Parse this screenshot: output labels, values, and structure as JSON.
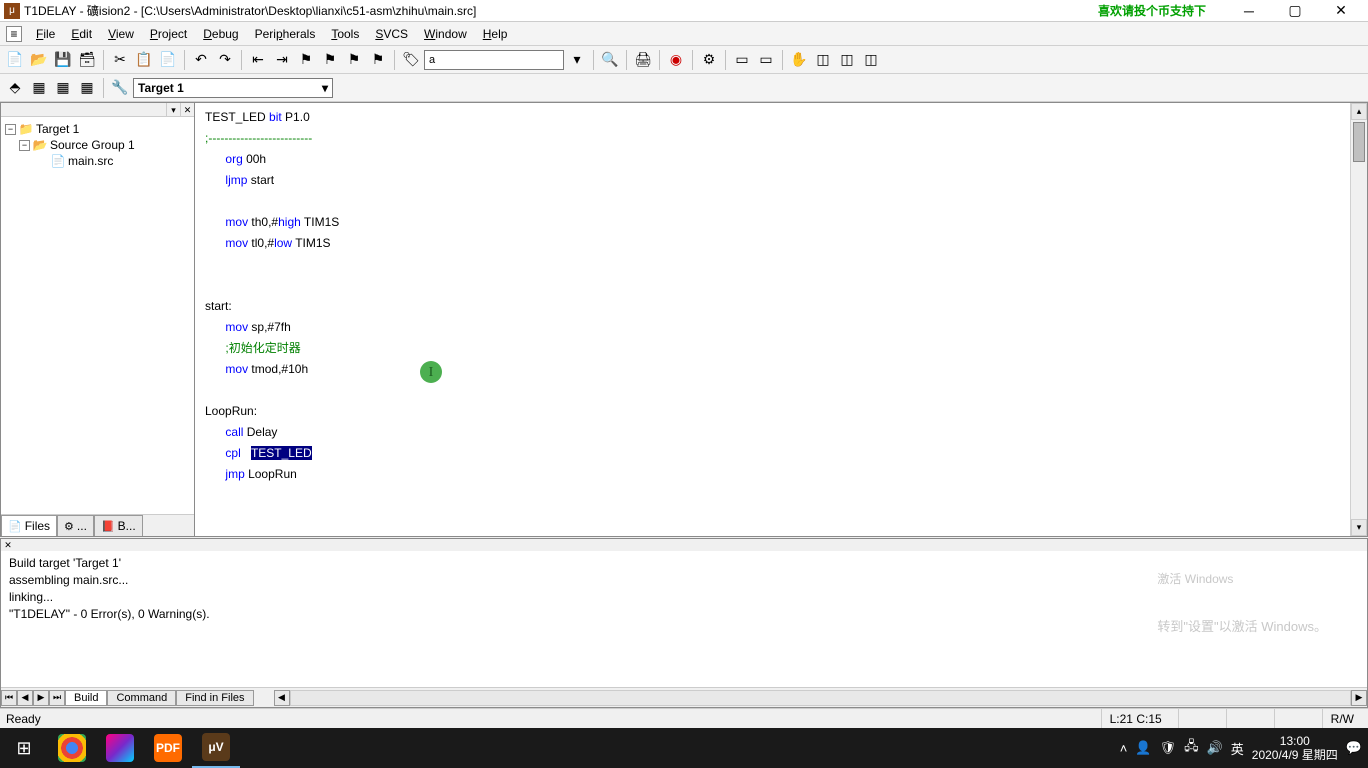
{
  "title_bar": {
    "title": "T1DELAY  - 礦ision2 - [C:\\Users\\Administrator\\Desktop\\lianxi\\c51-asm\\zhihu\\main.src]",
    "promo": "喜欢请投个币支持下"
  },
  "menus": [
    "File",
    "Edit",
    "View",
    "Project",
    "Debug",
    "Peripherals",
    "Tools",
    "SVCS",
    "Window",
    "Help"
  ],
  "target": "Target 1",
  "tree": {
    "root": "Target 1",
    "group": "Source Group 1",
    "file": "main.src"
  },
  "panel_tabs": [
    "Files",
    "...",
    "B..."
  ],
  "code": {
    "l1_a": "TEST_LED ",
    "l1_b": "bit",
    "l1_c": " P1.0",
    "l2": ";--------------------------",
    "l3_a": "org",
    "l3_b": " 00h",
    "l4_a": "ljmp",
    "l4_b": " start",
    "l6_a": "mov",
    "l6_b": " th0,#",
    "l6_c": "high",
    "l6_d": " TIM1S",
    "l7_a": "mov",
    "l7_b": " tl0,#",
    "l7_c": "low",
    "l7_d": " TIM1S",
    "l10": "start:",
    "l11_a": "mov",
    "l11_b": " sp,#7fh",
    "l12": ";初始化定时器",
    "l13_a": "mov",
    "l13_b": " tmod,#10h",
    "l15": "LoopRun:",
    "l16_a": "call",
    "l16_b": " Delay",
    "l17_a": "cpl",
    "l17_b": "TEST_LED",
    "l18_a": "jmp",
    "l18_b": " LoopRun"
  },
  "output": {
    "lines": "Build target 'Target 1'\nassembling main.src...\nlinking...\n\"T1DELAY\" - 0 Error(s), 0 Warning(s).",
    "watermark_title": "激活 Windows",
    "watermark_sub": "转到\"设置\"以激活 Windows。"
  },
  "output_tabs": [
    "Build",
    "Command",
    "Find in Files"
  ],
  "status": {
    "ready": "Ready",
    "pos": "L:21 C:15",
    "rw": "R/W"
  },
  "tray": {
    "ime": "英",
    "time": "13:00",
    "date": "2020/4/9 星期四"
  }
}
